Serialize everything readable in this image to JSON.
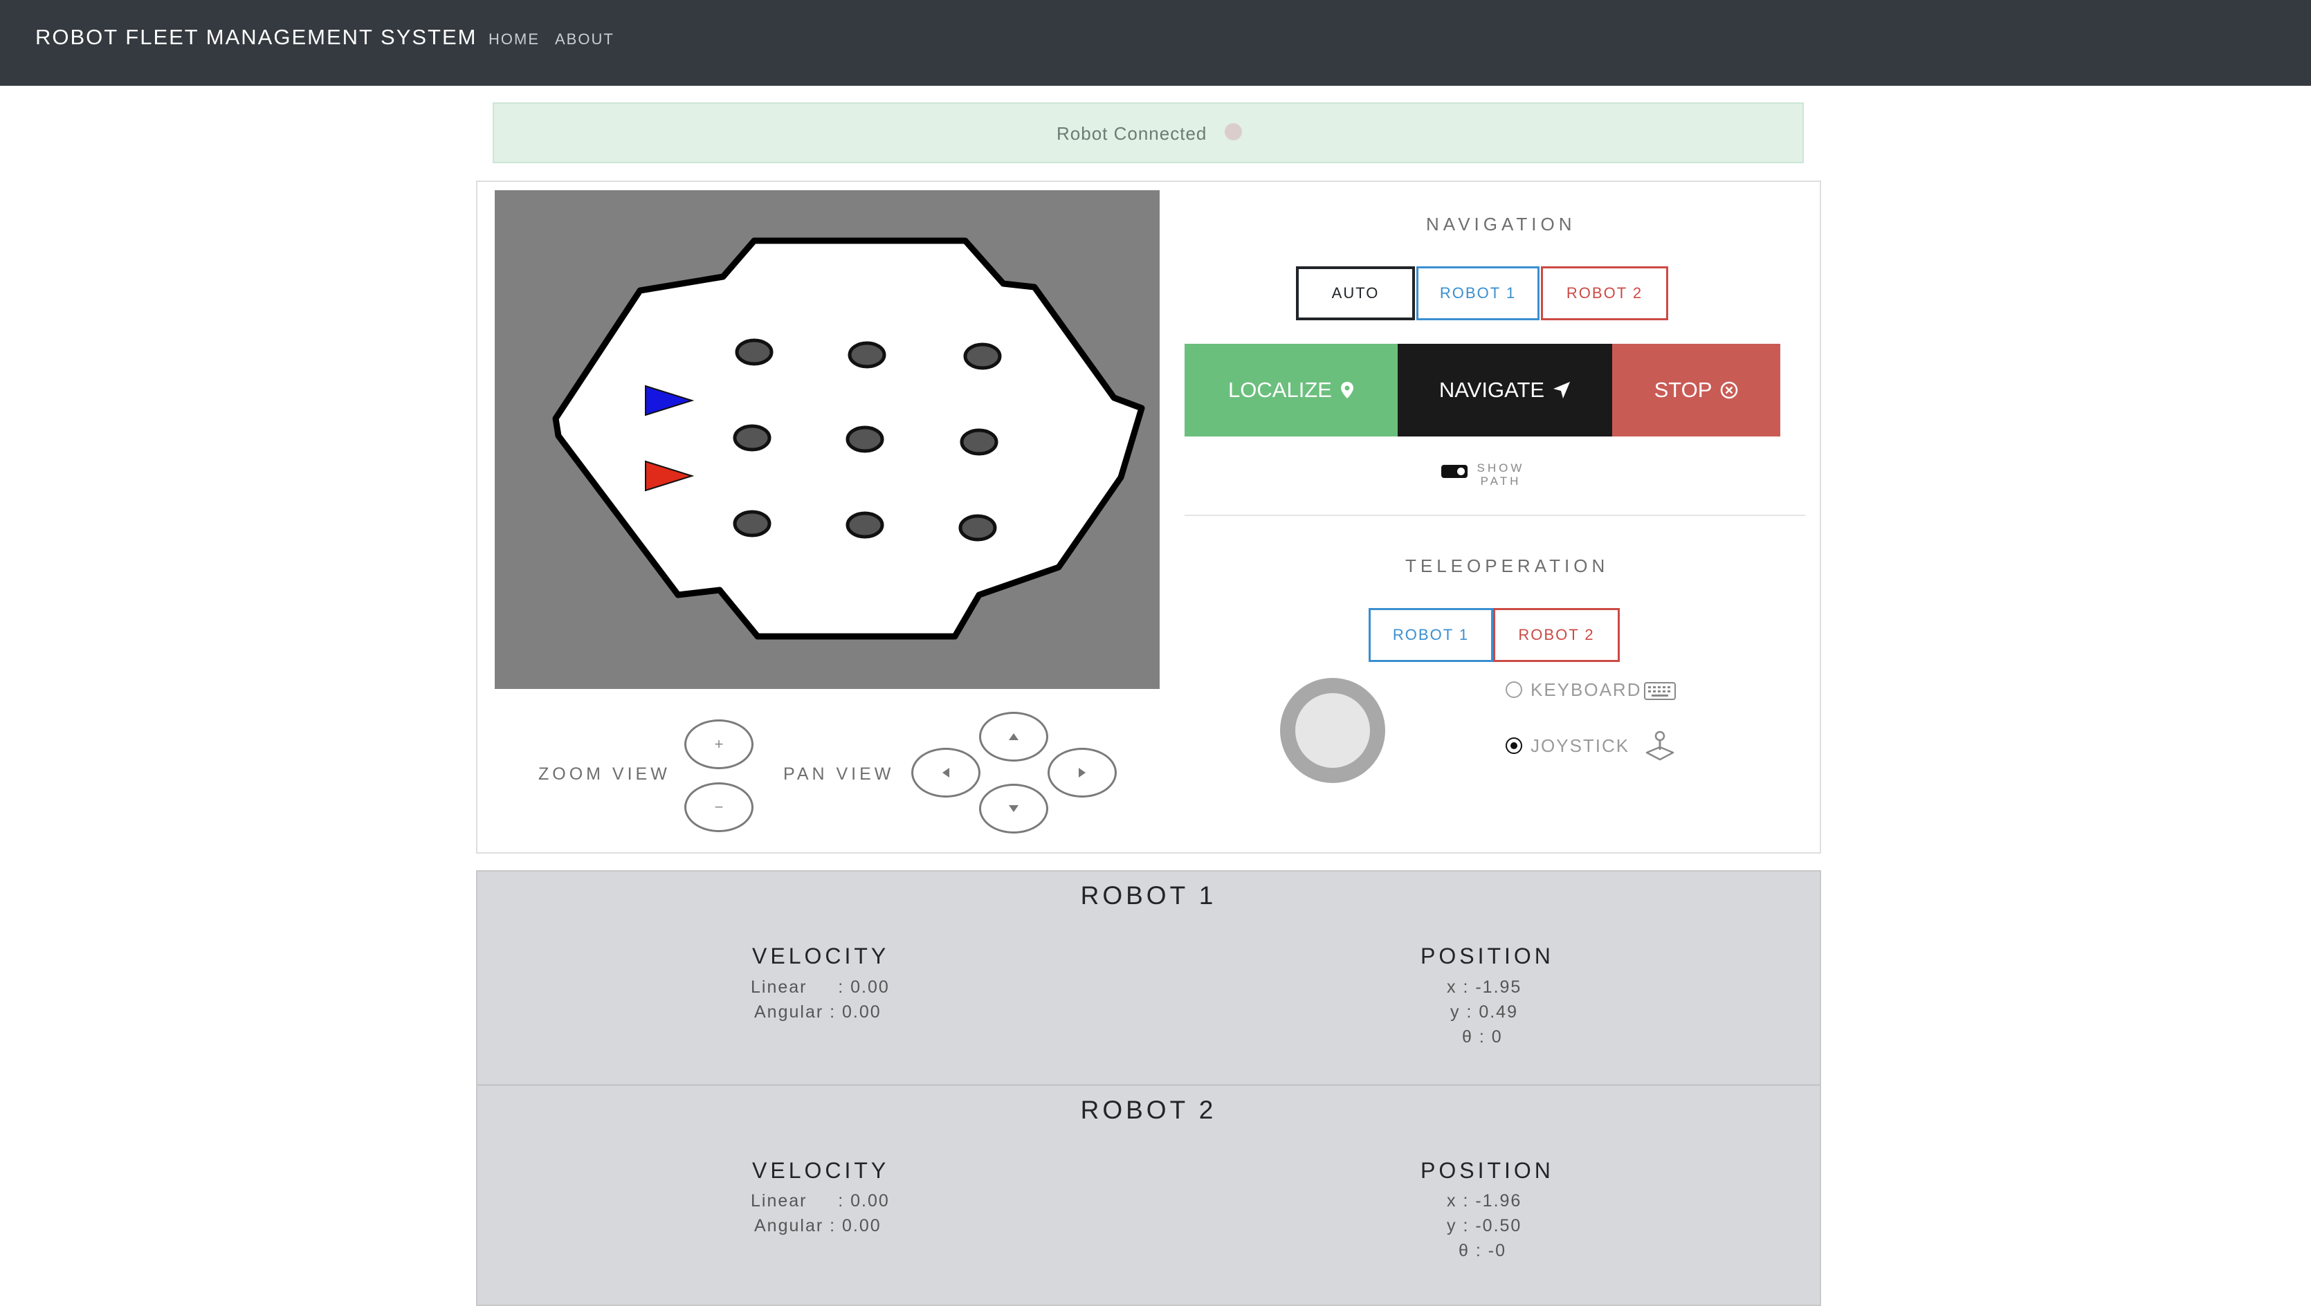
{
  "navbar": {
    "brand": "ROBOT FLEET MANAGEMENT SYSTEM",
    "links": [
      "HOME",
      "ABOUT"
    ]
  },
  "alert": {
    "text": "Robot Connected"
  },
  "map_controls": {
    "zoom_label": "ZOOM VIEW",
    "pan_label": "PAN VIEW",
    "zoom_in": "+",
    "zoom_out": "−"
  },
  "navigation": {
    "title": "NAVIGATION",
    "modes": [
      "AUTO",
      "ROBOT 1",
      "ROBOT 2"
    ],
    "localize": "LOCALIZE",
    "navigate": "NAVIGATE",
    "stop": "STOP",
    "show_path_line1": "SHOW",
    "show_path_line2": "PATH"
  },
  "teleoperation": {
    "title": "TELEOPERATION",
    "robots": [
      "ROBOT 1",
      "ROBOT 2"
    ],
    "keyboard": "KEYBOARD",
    "joystick": "JOYSTICK",
    "selected": "JOYSTICK"
  },
  "robots": [
    {
      "name": "ROBOT 1",
      "velocity_title": "VELOCITY",
      "linear": "Linear     : 0.00",
      "angular": "Angular : 0.00",
      "position_title": "POSITION",
      "x": "x : -1.95",
      "y": "y : 0.49",
      "theta": "θ : 0"
    },
    {
      "name": "ROBOT 2",
      "velocity_title": "VELOCITY",
      "linear": "Linear     : 0.00",
      "angular": "Angular : 0.00",
      "position_title": "POSITION",
      "x": "x : -1.96",
      "y": "y : -0.50",
      "theta": "θ : -0"
    }
  ],
  "colors": {
    "navbar": "#343a40",
    "robot1": "#1515e0",
    "robot2": "#e02a1a",
    "localize": "#6bbf7d",
    "stop": "#c95b55"
  }
}
